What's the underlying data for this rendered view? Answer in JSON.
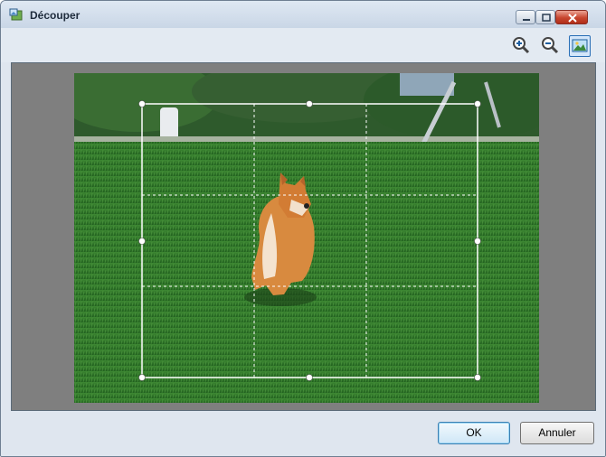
{
  "window": {
    "title": "Découper"
  },
  "icons": {
    "app": "crop-tool-icon",
    "minimize": "minimize-icon",
    "maximize": "maximize-icon",
    "close": "close-icon",
    "zoom_in": "zoom-in-icon",
    "zoom_out": "zoom-out-icon",
    "fit": "fit-to-window-icon"
  },
  "buttons": {
    "ok": "OK",
    "cancel": "Annuler"
  },
  "colors": {
    "canvas_bg": "#7f7f7f",
    "crop_frame": "#ffffff",
    "accent": "#2a6fb6"
  }
}
